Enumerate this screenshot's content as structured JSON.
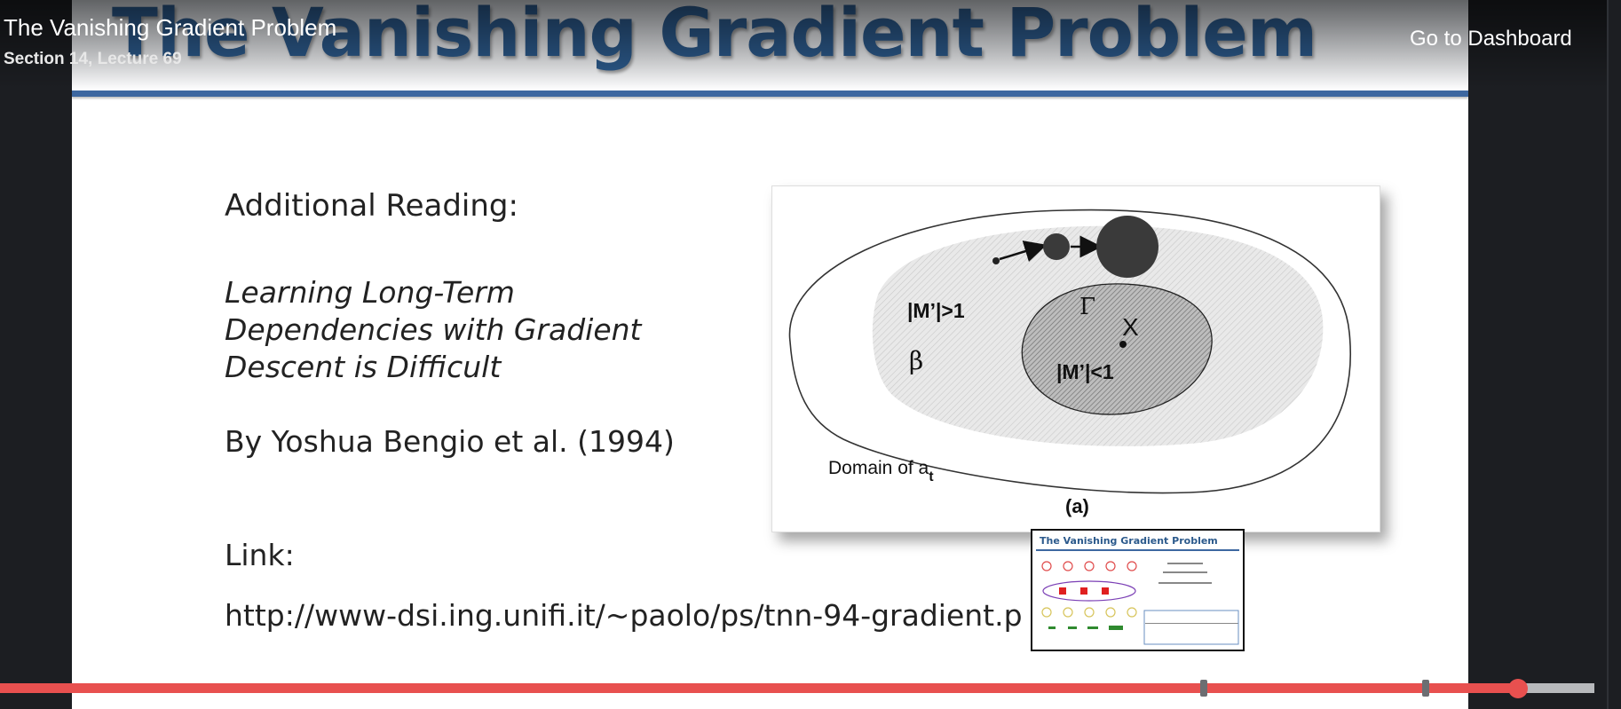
{
  "player": {
    "lecture_title": "The Vanishing Gradient Problem",
    "lecture_subtitle": "Section 14, Lecture 69",
    "dashboard_link": "Go to Dashboard",
    "progress_fraction": 0.952,
    "bookmarks": [
      0.755,
      0.894
    ]
  },
  "slide": {
    "title": "The Vanishing Gradient Problem",
    "reading_heading": "Additional Reading:",
    "paper_title_lines": [
      "Learning Long-Term",
      "Dependencies with Gradient",
      "Descent is Difficult"
    ],
    "author_line": "By Yoshua Bengio et al. (1994)",
    "link_label": "Link:",
    "link_url": "http://www-dsi.ing.unifi.it/~paolo/ps/tnn-94-gradient.p",
    "figure": {
      "label_outer": "|M’|>1",
      "label_inner": "|M’|<1",
      "label_gamma": "Γ",
      "label_beta": "β",
      "label_x": "X",
      "label_domain": "Domain of a",
      "label_domain_sub": "t",
      "caption": "(a)"
    }
  },
  "thumbnail": {
    "title": "The Vanishing Gradient Problem"
  },
  "colors": {
    "accent": "#e8504f",
    "slide_title": "#2c5a8c",
    "rule": "#3d67a0"
  }
}
